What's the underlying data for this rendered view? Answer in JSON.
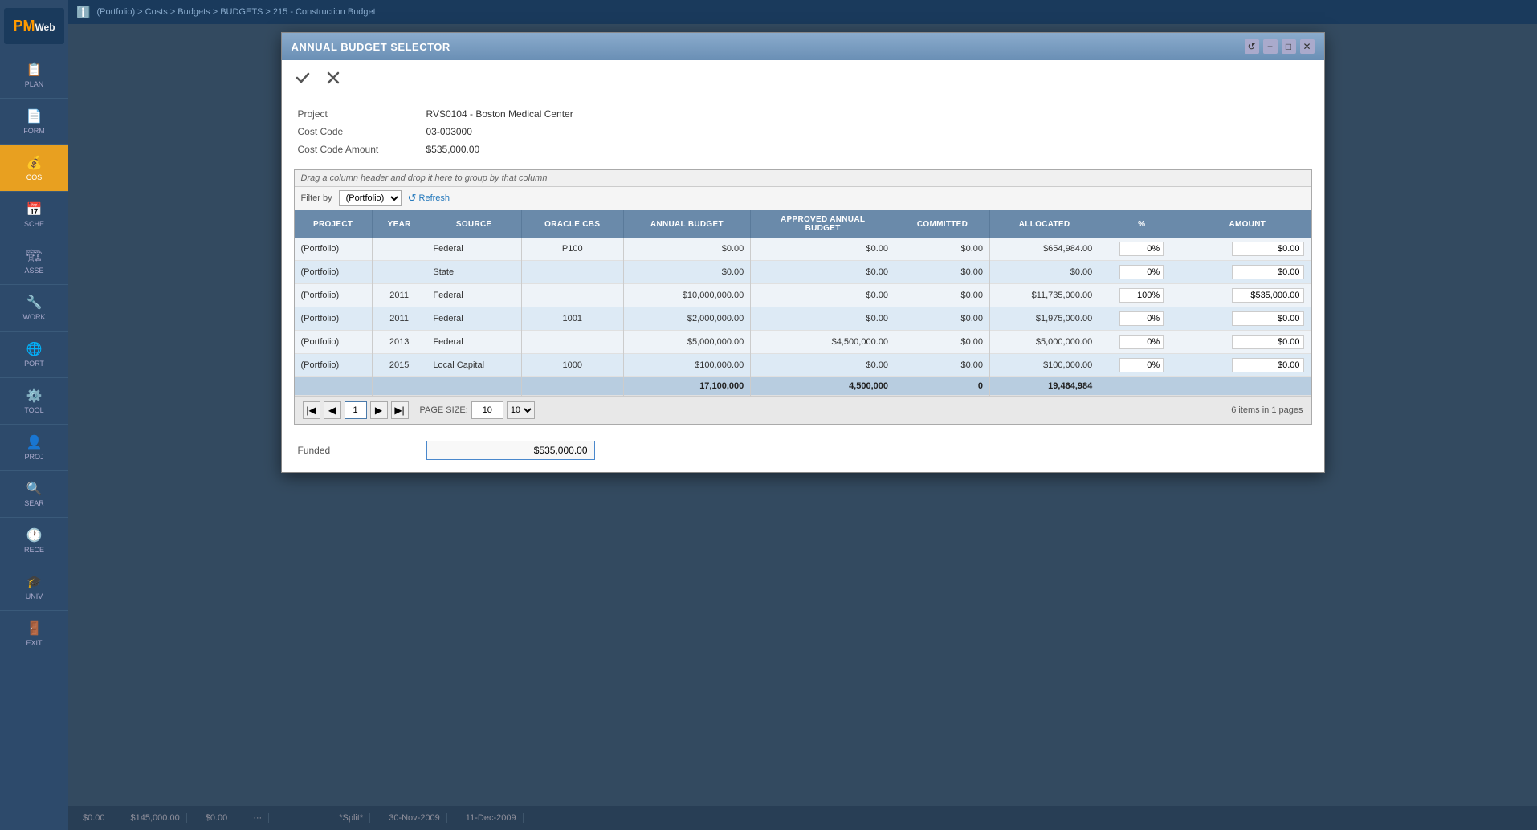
{
  "app": {
    "logo": "PMWeb",
    "breadcrumb": "(Portfolio) > Costs > Budgets > BUDGETS > 215 - Construction Budget"
  },
  "sidebar": {
    "items": [
      {
        "id": "plans",
        "label": "PLAN",
        "icon": "📋"
      },
      {
        "id": "forms",
        "label": "FORM",
        "icon": "📄"
      },
      {
        "id": "costs",
        "label": "COS",
        "icon": "💰",
        "active": true
      },
      {
        "id": "schedule",
        "label": "SCHE",
        "icon": "📅"
      },
      {
        "id": "assets",
        "label": "ASSE",
        "icon": "🏗"
      },
      {
        "id": "work",
        "label": "WORK",
        "icon": "🔧"
      },
      {
        "id": "portfolio",
        "label": "PORT",
        "icon": "🌐"
      },
      {
        "id": "tools",
        "label": "TOOL",
        "icon": "⚙️"
      },
      {
        "id": "projects",
        "label": "PROJ",
        "icon": "👤"
      },
      {
        "id": "search",
        "label": "SEAR",
        "icon": "🔍"
      },
      {
        "id": "recent",
        "label": "RECE",
        "icon": "🕐"
      },
      {
        "id": "univ",
        "label": "UNIV",
        "icon": "🎓"
      },
      {
        "id": "exit",
        "label": "EXIT",
        "icon": "🚪"
      }
    ]
  },
  "modal": {
    "title": "ANNUAL BUDGET SELECTOR",
    "confirm_label": "✓",
    "cancel_label": "✕",
    "controls": [
      "↺",
      "−",
      "□",
      "✕"
    ],
    "project_label": "Project",
    "project_value": "RVS0104 - Boston Medical Center",
    "cost_code_label": "Cost Code",
    "cost_code_value": "03-003000",
    "cost_code_amount_label": "Cost Code Amount",
    "cost_code_amount_value": "$535,000.00",
    "drag_hint": "Drag a column header and drop it here to group by that column",
    "filter_label": "Filter by",
    "filter_option": "(Portfolio)",
    "refresh_label": "Refresh",
    "columns": [
      "PROJECT",
      "YEAR",
      "SOURCE",
      "ORACLE CBS",
      "ANNUAL BUDGET",
      "APPROVED ANNUAL BUDGET",
      "COMMITTED",
      "ALLOCATED",
      "%",
      "AMOUNT"
    ],
    "rows": [
      {
        "project": "(Portfolio)",
        "year": "",
        "source": "Federal",
        "oracle_cbs": "P100",
        "annual_budget": "$0.00",
        "approved_annual_budget": "$0.00",
        "committed": "$0.00",
        "allocated": "$654,984.00",
        "percent": "0%",
        "amount": "$0.00"
      },
      {
        "project": "(Portfolio)",
        "year": "",
        "source": "State",
        "oracle_cbs": "",
        "annual_budget": "$0.00",
        "approved_annual_budget": "$0.00",
        "committed": "$0.00",
        "allocated": "$0.00",
        "percent": "0%",
        "amount": "$0.00"
      },
      {
        "project": "(Portfolio)",
        "year": "2011",
        "source": "Federal",
        "oracle_cbs": "",
        "annual_budget": "$10,000,000.00",
        "approved_annual_budget": "$0.00",
        "committed": "$0.00",
        "allocated": "$11,735,000.00",
        "percent": "100%",
        "amount": "$535,000.00"
      },
      {
        "project": "(Portfolio)",
        "year": "2011",
        "source": "Federal",
        "oracle_cbs": "1001",
        "annual_budget": "$2,000,000.00",
        "approved_annual_budget": "$0.00",
        "committed": "$0.00",
        "allocated": "$1,975,000.00",
        "percent": "0%",
        "amount": "$0.00"
      },
      {
        "project": "(Portfolio)",
        "year": "2013",
        "source": "Federal",
        "oracle_cbs": "",
        "annual_budget": "$5,000,000.00",
        "approved_annual_budget": "$4,500,000.00",
        "committed": "$0.00",
        "allocated": "$5,000,000.00",
        "percent": "0%",
        "amount": "$0.00"
      },
      {
        "project": "(Portfolio)",
        "year": "2015",
        "source": "Local Capital",
        "oracle_cbs": "1000",
        "annual_budget": "$100,000.00",
        "approved_annual_budget": "$0.00",
        "committed": "$0.00",
        "allocated": "$100,000.00",
        "percent": "0%",
        "amount": "$0.00"
      }
    ],
    "totals": {
      "annual_budget": "17,100,000",
      "approved_annual_budget": "4,500,000",
      "committed": "0",
      "allocated": "19,464,984"
    },
    "pagination": {
      "current_page": "1",
      "page_size": "10",
      "items_info": "6 items in 1 pages"
    },
    "funded_label": "Funded",
    "funded_value": "$535,000.00"
  },
  "bottom_bar": {
    "cells": [
      "$0.00",
      "$145,000.00",
      "$0.00",
      "···",
      "",
      "",
      "*Split*",
      "30-Nov-2009",
      "11-Dec-2009"
    ]
  },
  "cos_badge": "CoS"
}
